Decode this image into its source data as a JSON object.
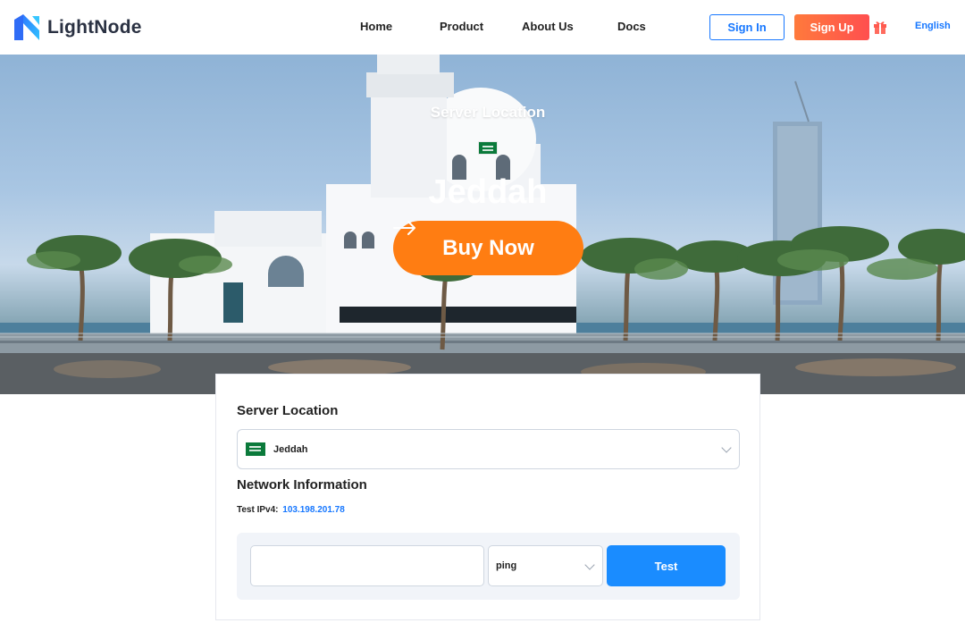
{
  "header": {
    "brand": "LightNode",
    "nav": [
      {
        "label": "Home"
      },
      {
        "label": "Product"
      },
      {
        "label": "About Us"
      },
      {
        "label": "Docs"
      }
    ],
    "sign_in": "Sign In",
    "sign_up": "Sign Up",
    "language": "English",
    "icons": {
      "gift": "gift-icon",
      "logo": "lightnode-logo-icon"
    }
  },
  "hero": {
    "subtitle": "Server Location",
    "title": "Jeddah",
    "buy_label": "Buy Now",
    "buy_icon": "arrow-right-icon",
    "flag_icon": "saudi-arabia-flag-icon"
  },
  "card": {
    "server_location_title": "Server Location",
    "location_selected": "Jeddah",
    "network_title": "Network Information",
    "ipv4_label": "Test IPv4:",
    "ipv4_value": "103.198.201.78",
    "test_input_value": "",
    "test_method_selected": "ping",
    "test_button": "Test"
  },
  "colors": {
    "accent_blue": "#1677ff",
    "buy_orange": "#ff7d12",
    "signup_gradient_start": "#ff7a3c",
    "signup_gradient_end": "#ff4f4f",
    "flag_green": "#0b7a3b"
  }
}
